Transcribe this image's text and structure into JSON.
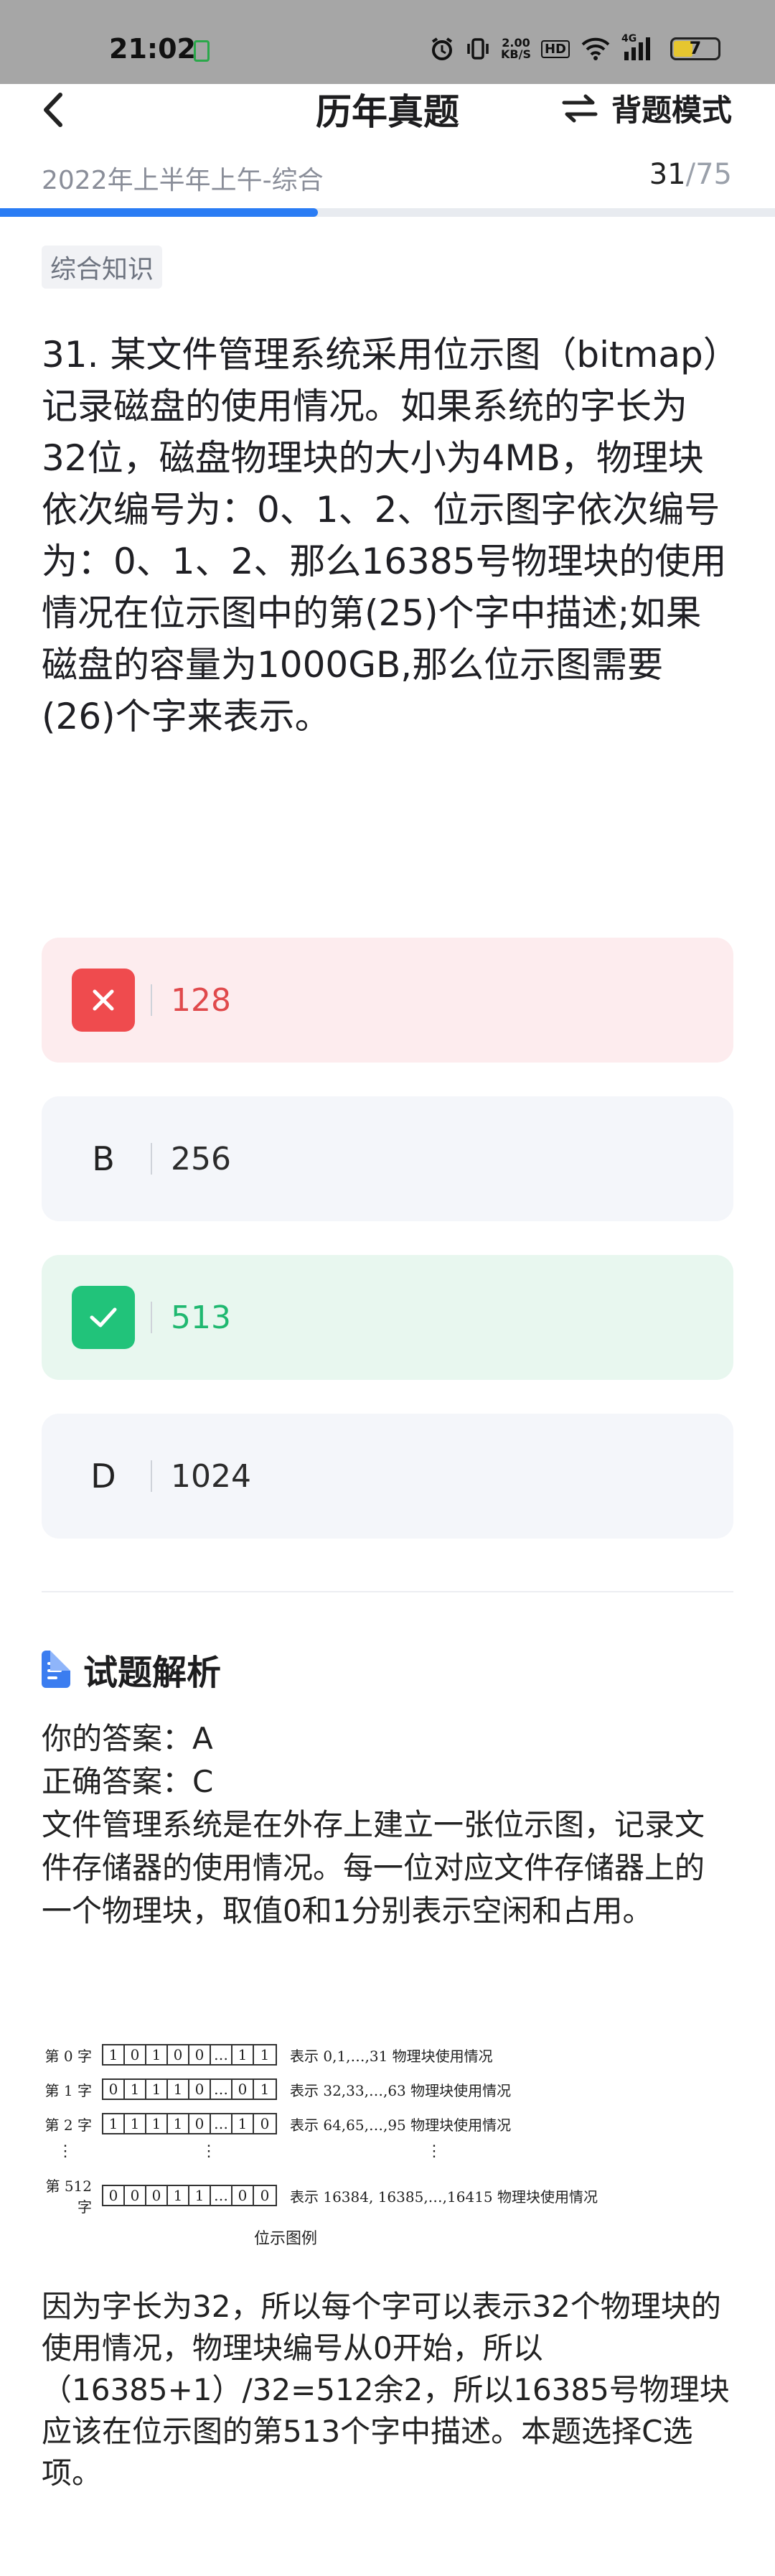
{
  "status_bar": {
    "time": "21:02",
    "net_speed_top": "2.00",
    "net_speed_bottom": "KB/S",
    "hd_label": "HD",
    "signal_label": "4G",
    "battery": "7"
  },
  "header": {
    "title": "历年真题",
    "mode_label": "背题模式"
  },
  "subheader": {
    "exam": "2022年上半年上午-综合",
    "current": "31",
    "total": "/75",
    "progress_percent": 41
  },
  "tag": "综合知识",
  "question": {
    "text": "31. 某文件管理系统采用位示图（bitmap）记录磁盘的使用情况。如果系统的字长为32位，磁盘物理块的大小为4MB，物理块依次编号为：0、1、2、位示图字依次编号为：0、1、2、那么16385号物理块的使用情况在位示图中的第(25)个字中描述;如果磁盘的容量为1000GB,那么位示图需要(26)个字来表示。"
  },
  "options": [
    {
      "letter": "A",
      "text": "128",
      "state": "wrong"
    },
    {
      "letter": "B",
      "text": "256",
      "state": "plain"
    },
    {
      "letter": "C",
      "text": "513",
      "state": "correct"
    },
    {
      "letter": "D",
      "text": "1024",
      "state": "plain"
    }
  ],
  "analysis": {
    "heading": "试题解析",
    "your_answer": "你的答案：A",
    "correct_answer": "正确答案：C",
    "para1": "文件管理系统是在外存上建立一张位示图，记录文件存储器的使用情况。每一位对应文件存储器上的一个物理块，取值0和1分别表示空闲和占用。",
    "para2": "因为字长为32，所以每个字可以表示32个物理块的使用情况，物理块编号从0开始，所以（16385+1）/32=512余2，所以16385号物理块应该在位示图的第513个字中描述。本题选择C选项。"
  },
  "bitmap_figure": {
    "rows": [
      {
        "label": "第 0 字",
        "bits": [
          "1",
          "0",
          "1",
          "0",
          "0",
          "…",
          "1",
          "1"
        ],
        "desc": "表示 0,1,…,31 物理块使用情况"
      },
      {
        "label": "第 1 字",
        "bits": [
          "0",
          "1",
          "1",
          "1",
          "0",
          "…",
          "0",
          "1"
        ],
        "desc": "表示 32,33,…,63 物理块使用情况"
      },
      {
        "label": "第 2 字",
        "bits": [
          "1",
          "1",
          "1",
          "1",
          "0",
          "…",
          "1",
          "0"
        ],
        "desc": "表示 64,65,…,95 物理块使用情况"
      },
      {
        "label": "第 512 字",
        "bits": [
          "0",
          "0",
          "0",
          "1",
          "1",
          "…",
          "0",
          "0"
        ],
        "desc": "表示 16384, 16385,…,16415 物理块使用情况"
      }
    ],
    "dots": "⋮",
    "caption": "位示图例"
  },
  "colors": {
    "accent": "#2a7cf4",
    "wrong": "#ef4b4e",
    "correct": "#21c37a"
  }
}
